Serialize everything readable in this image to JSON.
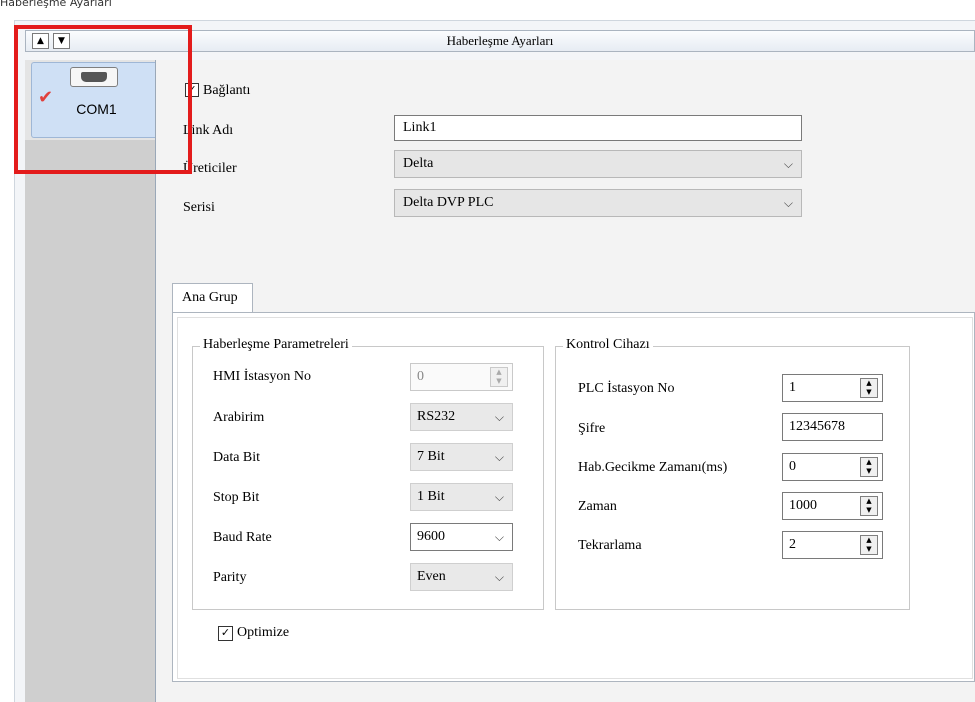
{
  "window": {
    "title": "Haberleşme Ayarları"
  },
  "header": {
    "title": "Haberleşme Ayarları",
    "up_glyph": "▲",
    "down_glyph": "▼"
  },
  "sidebar": {
    "items": [
      {
        "label": "COM1",
        "icon": "serial-port-icon",
        "checked": true
      }
    ]
  },
  "connection": {
    "checkbox_label": "Bağlantı",
    "checked": true,
    "fields": [
      {
        "label": "Link Adı",
        "value": "Link1",
        "type": "text"
      },
      {
        "label": "Üreticiler",
        "value": "Delta",
        "type": "select"
      },
      {
        "label": "Serisi",
        "value": "Delta DVP PLC",
        "type": "select"
      }
    ]
  },
  "tabs": [
    {
      "label": "Ana Grup",
      "active": true
    }
  ],
  "comm_params": {
    "title": "Haberleşme Parametreleri",
    "rows": [
      {
        "label": "HMI İstasyon No",
        "value": "0",
        "type": "spinner",
        "disabled": true
      },
      {
        "label": "Arabirim",
        "value": "RS232",
        "type": "select"
      },
      {
        "label": "Data Bit",
        "value": "7 Bit",
        "type": "select"
      },
      {
        "label": "Stop Bit",
        "value": "1 Bit",
        "type": "select"
      },
      {
        "label": "Baud Rate",
        "value": "9600",
        "type": "select"
      },
      {
        "label": "Parity",
        "value": "Even",
        "type": "select"
      }
    ]
  },
  "controller": {
    "title": "Kontrol Cihazı",
    "rows": [
      {
        "label": "PLC İstasyon No",
        "value": "1",
        "type": "spinner"
      },
      {
        "label": "Şifre",
        "value": "12345678",
        "type": "text"
      },
      {
        "label": "Hab.Gecikme Zamanı(ms)",
        "value": "0",
        "type": "spinner"
      },
      {
        "label": "Zaman",
        "value": "1000",
        "type": "spinner"
      },
      {
        "label": "Tekrarlama",
        "value": "2",
        "type": "spinner"
      }
    ]
  },
  "optimize": {
    "label": "Optimize",
    "checked": true
  },
  "highlight": {
    "color": "#e31b1b"
  },
  "colors": {
    "selected_tab": "#cfe0f5",
    "check_red": "#e0403c"
  }
}
